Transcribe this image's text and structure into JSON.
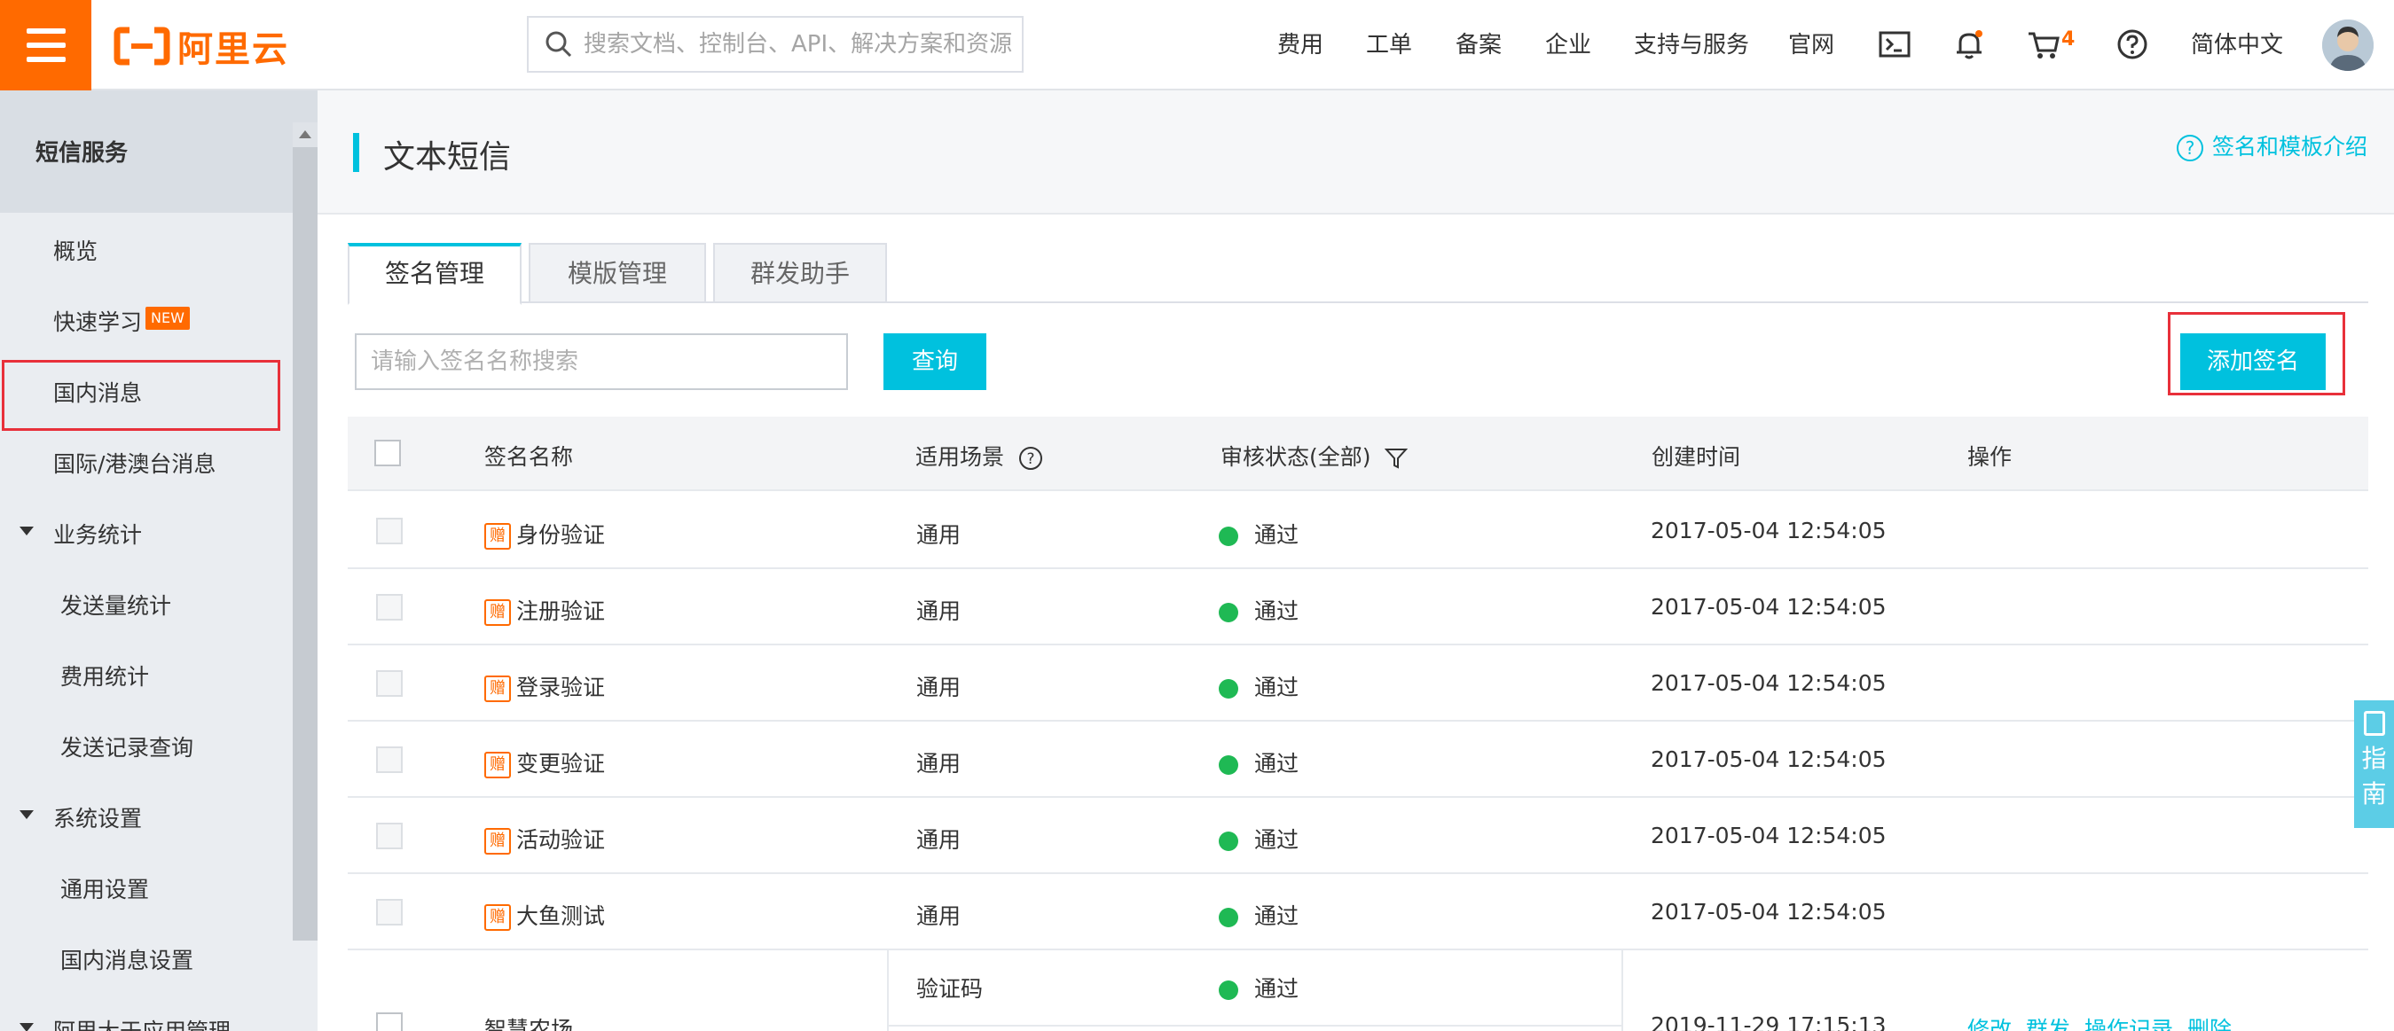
{
  "topbar": {
    "logo_text": "阿里云",
    "search_placeholder": "搜索文档、控制台、API、解决方案和资源",
    "nav": [
      "费用",
      "工单",
      "备案",
      "企业",
      "支持与服务",
      "官网"
    ],
    "cart_count": "4",
    "language": "简体中文"
  },
  "sidebar": {
    "header": "短信服务",
    "items": [
      {
        "label": "概览"
      },
      {
        "label": "快速学习",
        "badge": "NEW"
      },
      {
        "label": "国内消息"
      },
      {
        "label": "国际/港澳台消息"
      },
      {
        "label": "业务统计"
      },
      {
        "label": "发送量统计"
      },
      {
        "label": "费用统计"
      },
      {
        "label": "发送记录查询"
      },
      {
        "label": "系统设置"
      },
      {
        "label": "通用设置"
      },
      {
        "label": "国内消息设置"
      },
      {
        "label": "阿里大于应用管理"
      }
    ]
  },
  "page": {
    "title": "文本短信",
    "help_link": "签名和模板介绍"
  },
  "tabs": [
    "签名管理",
    "模版管理",
    "群发助手"
  ],
  "toolbar": {
    "search_placeholder": "请输入签名名称搜索",
    "query_label": "查询",
    "add_label": "添加签名"
  },
  "table": {
    "headers": [
      "签名名称",
      "适用场景",
      "审核状态(全部)",
      "创建时间",
      "操作"
    ],
    "gift_mark": "赠",
    "rows": [
      {
        "name": "身份验证",
        "scene": "通用",
        "status": "通过",
        "created": "2017-05-04 12:54:05"
      },
      {
        "name": "注册验证",
        "scene": "通用",
        "status": "通过",
        "created": "2017-05-04 12:54:05"
      },
      {
        "name": "登录验证",
        "scene": "通用",
        "status": "通过",
        "created": "2017-05-04 12:54:05"
      },
      {
        "name": "变更验证",
        "scene": "通用",
        "status": "通过",
        "created": "2017-05-04 12:54:05"
      },
      {
        "name": "活动验证",
        "scene": "通用",
        "status": "通过",
        "created": "2017-05-04 12:54:05"
      },
      {
        "name": "大鱼测试",
        "scene": "通用",
        "status": "通过",
        "created": "2017-05-04 12:54:05"
      }
    ],
    "partial_row": {
      "name": "智慧农场",
      "scene": "验证码",
      "status": "通过",
      "created": "2019-11-29 17:15:13",
      "actions": [
        "修改",
        "群发",
        "操作记录",
        "删除"
      ]
    }
  },
  "float_guide": {
    "label_1": "指",
    "label_2": "南"
  },
  "colors": {
    "brand": "#ff6a00",
    "accent": "#00c1de",
    "success": "#1fb954",
    "highlight": "#e8303a"
  }
}
